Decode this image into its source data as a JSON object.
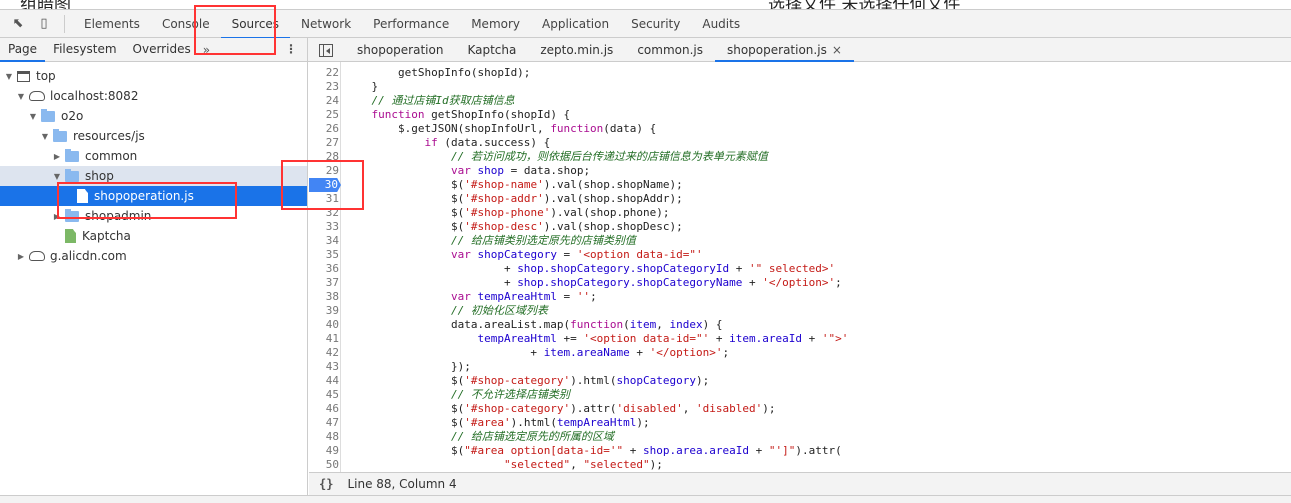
{
  "page_background": {
    "left_text": "组暗图",
    "right_text": "选择文件 未选择任何文件"
  },
  "devtools": {
    "main_tabs": [
      "Elements",
      "Console",
      "Sources",
      "Network",
      "Performance",
      "Memory",
      "Application",
      "Security",
      "Audits"
    ],
    "active_main_tab": "Sources",
    "navigator_tabs": [
      "Page",
      "Filesystem",
      "Overrides"
    ],
    "more_label": "»",
    "menu_label": "⋮",
    "file_tabs": [
      "shopoperation",
      "Kaptcha",
      "zepto.min.js",
      "common.js",
      "shopoperation.js"
    ],
    "active_file_tab": "shopoperation.js",
    "close_label": "×"
  },
  "tree": [
    {
      "label": "top",
      "icon": "frame-icon",
      "depth": 0,
      "expanded": true
    },
    {
      "label": "localhost:8082",
      "icon": "cloud-icon",
      "depth": 1,
      "expanded": true
    },
    {
      "label": "o2o",
      "icon": "folder-icon",
      "depth": 2,
      "expanded": true
    },
    {
      "label": "resources/js",
      "icon": "folder-icon",
      "depth": 3,
      "expanded": true
    },
    {
      "label": "common",
      "icon": "folder-icon",
      "depth": 4,
      "expanded": false
    },
    {
      "label": "shop",
      "icon": "folder-icon",
      "depth": 4,
      "expanded": true,
      "state": "hover"
    },
    {
      "label": "shopoperation.js",
      "icon": "file-icon",
      "depth": 5,
      "state": "selected"
    },
    {
      "label": "shopadmin",
      "icon": "folder-icon",
      "depth": 4,
      "expanded": false
    },
    {
      "label": "Kaptcha",
      "icon": "file-green-icon",
      "depth": 4
    },
    {
      "label": "g.alicdn.com",
      "icon": "cloud-icon",
      "depth": 1,
      "expanded": false
    }
  ],
  "editor": {
    "breakpoint_line": 30,
    "lines": [
      {
        "n": 22,
        "t": [
          [
            "",
            "        getShopInfo(shopId);"
          ]
        ]
      },
      {
        "n": 23,
        "t": [
          [
            "",
            "    }"
          ]
        ]
      },
      {
        "n": 24,
        "t": [
          [
            "cm",
            "    // 通过店铺Id获取店铺信息"
          ]
        ]
      },
      {
        "n": 25,
        "t": [
          [
            "kw",
            "    function"
          ],
          [
            "",
            " getShopInfo(shopId) {"
          ]
        ]
      },
      {
        "n": 26,
        "t": [
          [
            "",
            "        $.getJSON(shopInfoUrl, "
          ],
          [
            "kw",
            "function"
          ],
          [
            "",
            "(data) {"
          ]
        ]
      },
      {
        "n": 27,
        "t": [
          [
            "kw",
            "            if"
          ],
          [
            "",
            " (data.success) {"
          ]
        ]
      },
      {
        "n": 28,
        "t": [
          [
            "cm",
            "                // 若访问成功，则依据后台传递过来的店铺信息为表单元素赋值"
          ]
        ]
      },
      {
        "n": 29,
        "t": [
          [
            "kw",
            "                var"
          ],
          [
            "id",
            " shop"
          ],
          [
            "",
            " = data.shop;"
          ]
        ]
      },
      {
        "n": 30,
        "t": [
          [
            "",
            "                $("
          ],
          [
            "str",
            "'#shop-name'"
          ],
          [
            "",
            ").val(shop.shopName);"
          ]
        ]
      },
      {
        "n": 31,
        "t": [
          [
            "",
            "                $("
          ],
          [
            "str",
            "'#shop-addr'"
          ],
          [
            "",
            ").val(shop.shopAddr);"
          ]
        ]
      },
      {
        "n": 32,
        "t": [
          [
            "",
            "                $("
          ],
          [
            "str",
            "'#shop-phone'"
          ],
          [
            "",
            ").val(shop.phone);"
          ]
        ]
      },
      {
        "n": 33,
        "t": [
          [
            "",
            "                $("
          ],
          [
            "str",
            "'#shop-desc'"
          ],
          [
            "",
            ").val(shop.shopDesc);"
          ]
        ]
      },
      {
        "n": 34,
        "t": [
          [
            "cm",
            "                // 给店铺类别选定原先的店铺类别值"
          ]
        ]
      },
      {
        "n": 35,
        "t": [
          [
            "kw",
            "                var"
          ],
          [
            "id",
            " shopCategory"
          ],
          [
            "",
            " = "
          ],
          [
            "str",
            "'<option data-id=\"'"
          ]
        ]
      },
      {
        "n": 36,
        "t": [
          [
            "",
            "                        + "
          ],
          [
            "id",
            "shop.shopCategory.shopCategoryId"
          ],
          [
            "",
            " + "
          ],
          [
            "str",
            "'\" selected>'"
          ]
        ]
      },
      {
        "n": 37,
        "t": [
          [
            "",
            "                        + "
          ],
          [
            "id",
            "shop.shopCategory.shopCategoryName"
          ],
          [
            "",
            " + "
          ],
          [
            "str",
            "'</option>'"
          ],
          [
            "",
            ";"
          ]
        ]
      },
      {
        "n": 38,
        "t": [
          [
            "kw",
            "                var"
          ],
          [
            "id",
            " tempAreaHtml"
          ],
          [
            "",
            " = "
          ],
          [
            "str",
            "''"
          ],
          [
            "",
            ";"
          ]
        ]
      },
      {
        "n": 39,
        "t": [
          [
            "cm",
            "                // 初始化区域列表"
          ]
        ]
      },
      {
        "n": 40,
        "t": [
          [
            "",
            "                data.areaList.map("
          ],
          [
            "kw",
            "function"
          ],
          [
            "",
            "("
          ],
          [
            "id",
            "item"
          ],
          [
            "",
            ", "
          ],
          [
            "id",
            "index"
          ],
          [
            "",
            ") {"
          ]
        ]
      },
      {
        "n": 41,
        "t": [
          [
            "id",
            "                    tempAreaHtml"
          ],
          [
            "",
            " += "
          ],
          [
            "str",
            "'<option data-id=\"'"
          ],
          [
            "",
            " + "
          ],
          [
            "id",
            "item.areaId"
          ],
          [
            "",
            " + "
          ],
          [
            "str",
            "'\">'"
          ]
        ]
      },
      {
        "n": 42,
        "t": [
          [
            "",
            "                            + "
          ],
          [
            "id",
            "item.areaName"
          ],
          [
            "",
            " + "
          ],
          [
            "str",
            "'</option>'"
          ],
          [
            "",
            ";"
          ]
        ]
      },
      {
        "n": 43,
        "t": [
          [
            "",
            "                });"
          ]
        ]
      },
      {
        "n": 44,
        "t": [
          [
            "",
            "                $("
          ],
          [
            "str",
            "'#shop-category'"
          ],
          [
            "",
            ").html("
          ],
          [
            "id",
            "shopCategory"
          ],
          [
            "",
            ");"
          ]
        ]
      },
      {
        "n": 45,
        "t": [
          [
            "cm",
            "                // 不允许选择店铺类别"
          ]
        ]
      },
      {
        "n": 46,
        "t": [
          [
            "",
            "                $("
          ],
          [
            "str",
            "'#shop-category'"
          ],
          [
            "",
            ").attr("
          ],
          [
            "str",
            "'disabled'"
          ],
          [
            "",
            ", "
          ],
          [
            "str",
            "'disabled'"
          ],
          [
            "",
            ");"
          ]
        ]
      },
      {
        "n": 47,
        "t": [
          [
            "",
            "                $("
          ],
          [
            "str",
            "'#area'"
          ],
          [
            "",
            ").html("
          ],
          [
            "id",
            "tempAreaHtml"
          ],
          [
            "",
            ");"
          ]
        ]
      },
      {
        "n": 48,
        "t": [
          [
            "cm",
            "                // 给店铺选定原先的所属的区域"
          ]
        ]
      },
      {
        "n": 49,
        "t": [
          [
            "",
            "                $("
          ],
          [
            "str",
            "\"#area option[data-id='\""
          ],
          [
            "",
            " + "
          ],
          [
            "id",
            "shop.area.areaId"
          ],
          [
            "",
            " + "
          ],
          [
            "str",
            "\"']\""
          ],
          [
            "",
            ").attr("
          ]
        ]
      },
      {
        "n": 50,
        "t": [
          [
            "",
            "                        "
          ],
          [
            "str",
            "\"selected\""
          ],
          [
            "",
            ", "
          ],
          [
            "str",
            "\"selected\""
          ],
          [
            "",
            ");"
          ]
        ]
      }
    ]
  },
  "status_bar": {
    "format_label": "{}",
    "position": "Line 88, Column 4"
  },
  "colors": {
    "accent": "#1a73e8",
    "breakpoint": "#4285f4",
    "annotation": "#ff3333",
    "keyword": "#aa0d91",
    "string": "#c41a16",
    "comment": "#236e25"
  }
}
